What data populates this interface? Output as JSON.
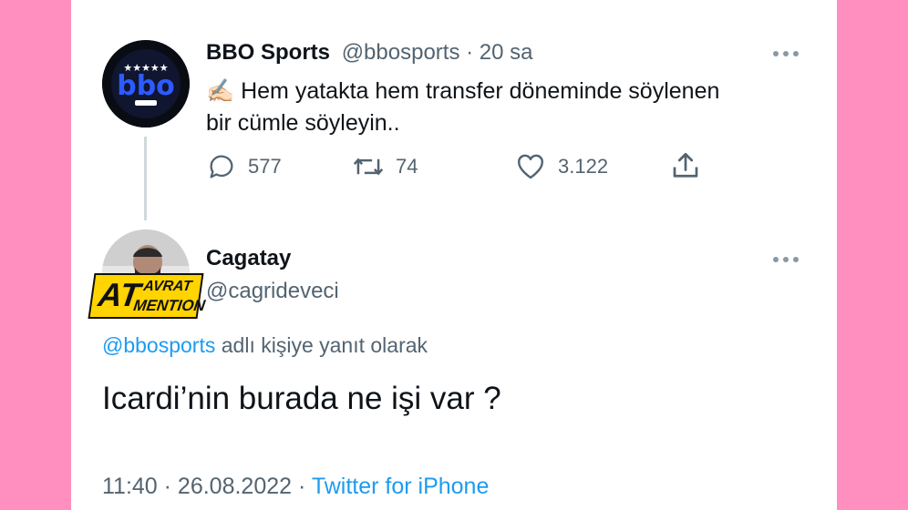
{
  "tweet": {
    "author_name": "BBO Sports",
    "author_handle": "@bbosports",
    "separator": "·",
    "time": "20 sa",
    "emoji": "✍🏻",
    "text_line1": "Hem yatakta hem transfer döneminde söylenen",
    "text_line2": "bir cümle söyleyin..",
    "avatar_icon": "bbo-logo-icon",
    "stats": {
      "replies": "577",
      "retweets": "74",
      "likes": "3.122"
    }
  },
  "reply": {
    "author_name": "Cagatay",
    "author_handle": "@cagrideveci",
    "avatar_badge_line1": "AT",
    "avatar_badge_line2": "AVRAT",
    "avatar_badge_line3": "MENTION",
    "replying_to_handle": "@bbosports",
    "replying_to_suffix": "adlı kişiye yanıt olarak",
    "text": "Icardi’nin burada ne işi var ?",
    "footer_time": "11:40 · 26.08.2022 ·",
    "footer_source": "Twitter for iPhone"
  },
  "colors": {
    "background": "#ff8fbf",
    "link": "#1d9bf0",
    "muted": "#536471",
    "text": "#0f1419"
  }
}
